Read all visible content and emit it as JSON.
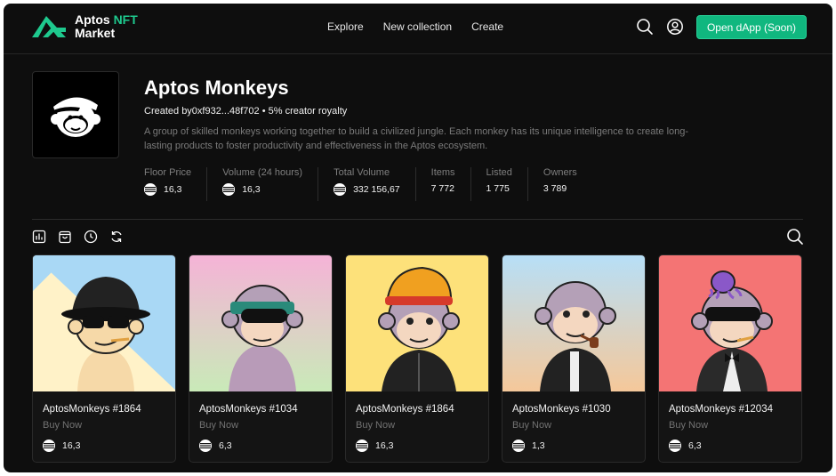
{
  "header": {
    "logo_line1": "Aptos ",
    "logo_accent": "NFT",
    "logo_line2": "Market",
    "nav": [
      "Explore",
      "New collection",
      "Create"
    ],
    "open_dapp_label": "Open dApp (Soon)"
  },
  "collection": {
    "name": "Aptos Monkeys",
    "created_line": "Created by0xf932...48f702 • 5% creator royalty",
    "description": "A group of skilled monkeys working together to build a civilized jungle. Each monkey has its unique intelligence to create long-lasting products to foster productivity and effectiveness in the Aptos ecosystem.",
    "stats": [
      {
        "label": "Floor Price",
        "value": "16,3",
        "coin": true
      },
      {
        "label": "Volume (24 hours)",
        "value": "16,3",
        "coin": true
      },
      {
        "label": "Total Volume",
        "value": "332 156,67",
        "coin": true
      },
      {
        "label": "Items",
        "value": "7 772",
        "coin": false
      },
      {
        "label": "Listed",
        "value": "1 775",
        "coin": false
      },
      {
        "label": "Owners",
        "value": "3 789",
        "coin": false
      }
    ]
  },
  "toolbar_icons": [
    "chart-icon",
    "bag-icon",
    "clock-icon",
    "refresh-icon"
  ],
  "cards": [
    {
      "name": "AptosMonkeys #1864",
      "action": "Buy Now",
      "price": "16,3",
      "bg_top": "#a9d8f5",
      "bg_bottom": "#fff2c8",
      "accessory": "hat"
    },
    {
      "name": "AptosMonkeys #1034",
      "action": "Buy Now",
      "price": "6,3",
      "bg_top": "#f5b3d7",
      "bg_bottom": "#c9eab8",
      "accessory": "bandana"
    },
    {
      "name": "AptosMonkeys #1864",
      "action": "Buy Now",
      "price": "16,3",
      "bg_top": "#fde17a",
      "bg_bottom": "#fde17a",
      "accessory": "beanie"
    },
    {
      "name": "AptosMonkeys #1030",
      "action": "Buy Now",
      "price": "1,3",
      "bg_top": "#b7dff7",
      "bg_bottom": "#f5c89a",
      "accessory": "pipe"
    },
    {
      "name": "AptosMonkeys #12034",
      "action": "Buy Now",
      "price": "6,3",
      "bg_top": "#f47474",
      "bg_bottom": "#f47474",
      "accessory": "octopus"
    }
  ],
  "colors": {
    "accent": "#10b77f",
    "background": "#0e0e0e"
  }
}
